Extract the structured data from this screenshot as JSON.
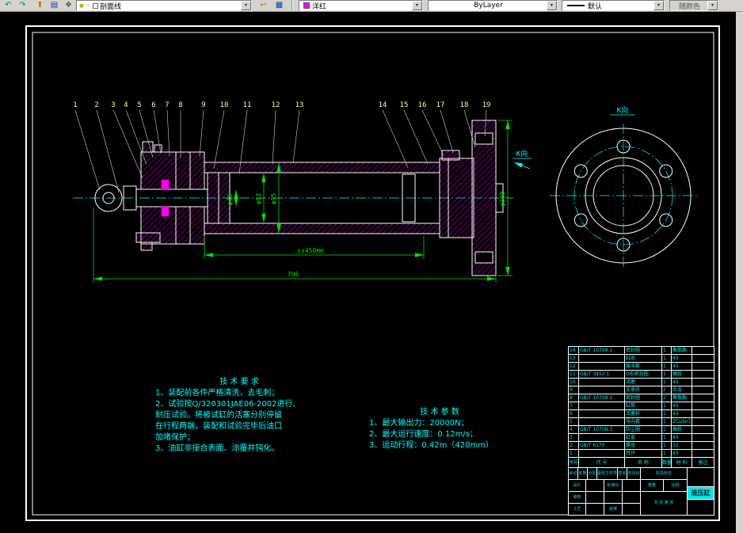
{
  "toolbar": {
    "layer_control": {
      "value": "剖面线"
    },
    "color_control": {
      "value": "洋红"
    },
    "linetype_control": {
      "value": "ByLayer"
    },
    "lineweight_control": {
      "value": "默认"
    },
    "plotstyle_control": {
      "value": "随颜色"
    }
  },
  "drawing": {
    "callouts": [
      "1",
      "2",
      "3",
      "4",
      "5",
      "6",
      "7",
      "8",
      "9",
      "10",
      "11",
      "12",
      "13",
      "14",
      "15",
      "16",
      "17",
      "18",
      "19"
    ],
    "view_label": "K向",
    "dims": {
      "rod_dia": "φ40",
      "bore_dia": "φ82",
      "barrel_od": "φ95",
      "stroke_len": "ss450mm",
      "total_len": "796",
      "flange_dia": "φ300"
    },
    "tech_requirements": {
      "title": "技 术 要 求",
      "lines": [
        "1、装配前各件严格清洗，去毛刺；",
        "2、试验按Q/320301JAE06-2002进行,",
        "耐压试验。将被试缸的活塞分别停留",
        "在行程两端，装配和试验完毕后油口",
        "加堵保护；",
        "3、油缸非接合表面、涂覆并钝化。"
      ]
    },
    "tech_params": {
      "title": "技 术 参 数",
      "lines": [
        "1、最大输出力：20000N；",
        "2、最大运行速度：0.12m/s；",
        "3、运动行程：0.42m（420mm）"
      ]
    }
  },
  "title_block": {
    "parts": [
      {
        "seq": "14",
        "code": "GB/T 10708.1",
        "name": "密封圈",
        "qty": "1",
        "mat": "聚氨酯",
        "note": ""
      },
      {
        "seq": "13",
        "code": "",
        "name": "缸底",
        "qty": "1",
        "mat": "45",
        "note": ""
      },
      {
        "seq": "12",
        "code": "",
        "name": "缓冲套",
        "qty": "1",
        "mat": "45",
        "note": ""
      },
      {
        "seq": "11",
        "code": "GB/T 3452.1",
        "name": "O形密封圈",
        "qty": "1",
        "mat": "橡胶",
        "note": ""
      },
      {
        "seq": "10",
        "code": "",
        "name": "活塞",
        "qty": "1",
        "mat": "45",
        "note": ""
      },
      {
        "seq": "9",
        "code": "",
        "name": "支承环",
        "qty": "2",
        "mat": "尼龙",
        "note": ""
      },
      {
        "seq": "8",
        "code": "GB/T 10708.1",
        "name": "密封圈",
        "qty": "2",
        "mat": "聚氨酯",
        "note": ""
      },
      {
        "seq": "7",
        "code": "",
        "name": "缸筒",
        "qty": "1",
        "mat": "45",
        "note": ""
      },
      {
        "seq": "6",
        "code": "",
        "name": "活塞杆",
        "qty": "1",
        "mat": "45",
        "note": ""
      },
      {
        "seq": "5",
        "code": "",
        "name": "导向套",
        "qty": "1",
        "mat": "ZCuSn10",
        "note": ""
      },
      {
        "seq": "4",
        "code": "GB/T 10708.3",
        "name": "防尘圈",
        "qty": "1",
        "mat": "橡胶",
        "note": ""
      },
      {
        "seq": "3",
        "code": "",
        "name": "缸盖",
        "qty": "1",
        "mat": "45",
        "note": ""
      },
      {
        "seq": "2",
        "code": "GB/T 6170",
        "name": "螺母",
        "qty": "1",
        "mat": "35",
        "note": ""
      },
      {
        "seq": "1",
        "code": "",
        "name": "耳环",
        "qty": "1",
        "mat": "45",
        "note": ""
      }
    ],
    "header": {
      "seq": "序号",
      "code": "代 号",
      "name": "名 称",
      "qty": "数量",
      "mat": "材 料",
      "note": "备注"
    },
    "bottom_rows": [
      [
        "标记",
        "处数",
        "分区",
        "更改文件号",
        "签名",
        "年月日"
      ],
      [
        "设计",
        "",
        "标准化",
        ""
      ],
      [
        "审核",
        "",
        "",
        ""
      ],
      [
        "工艺",
        "",
        "批准",
        ""
      ]
    ],
    "stage_label": "阶段标记",
    "weight_label": "重量",
    "scale_label": "比例",
    "sheet_label": "共 张 第 张",
    "part_name": "液压缸"
  }
}
